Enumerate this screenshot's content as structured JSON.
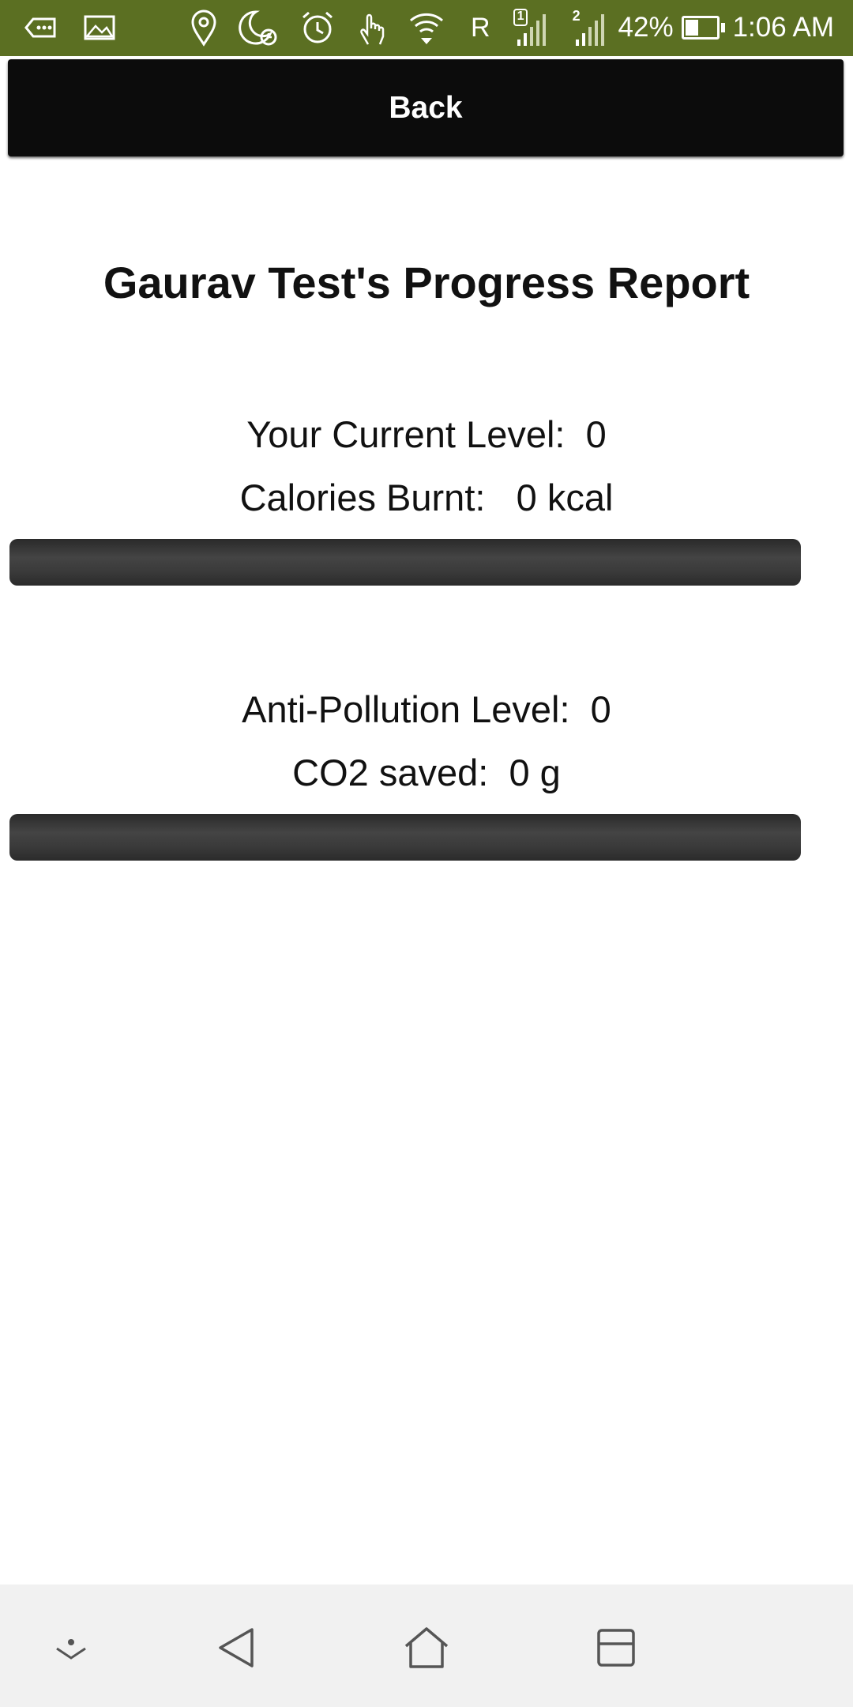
{
  "status_bar": {
    "carrier_indicator": "R",
    "sim1_label": "1",
    "sim2_label": "2",
    "battery_percent": "42%",
    "battery_level": 0.42,
    "time": "1:06 AM",
    "icons": [
      "voicemail-icon",
      "image-icon",
      "location-icon",
      "do-not-disturb-icon",
      "alarm-icon",
      "touch-icon",
      "wifi-icon",
      "signal-icon",
      "signal-icon",
      "battery-icon"
    ]
  },
  "header": {
    "back_label": "Back"
  },
  "report": {
    "title": "Gaurav Test's Progress Report",
    "level_text": "Your Current Level:  0",
    "calories_text": "Calories Burnt:   0 kcal",
    "calories_progress": 0,
    "pollution_level_text": "Anti-Pollution Level:  0",
    "co2_text": "CO2 saved:  0 g",
    "co2_progress": 0
  },
  "nav_bar": {
    "icons": [
      "notification-pull-icon",
      "back-triangle-icon",
      "home-icon",
      "recents-icon"
    ]
  }
}
